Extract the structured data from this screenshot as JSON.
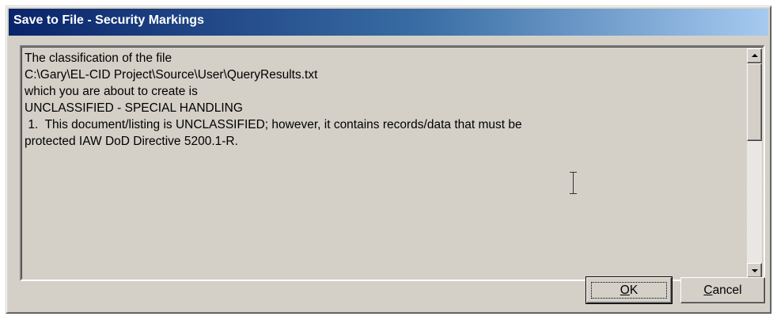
{
  "window": {
    "title": "Save to File - Security Markings"
  },
  "message": {
    "lines": [
      "The classification of the file",
      "",
      "C:\\Gary\\EL-CID Project\\Source\\User\\QueryResults.txt",
      "",
      "which you are about to create is",
      "",
      "UNCLASSIFIED - SPECIAL HANDLING",
      "",
      " 1.  This document/listing is UNCLASSIFIED; however, it contains records/data that must be",
      "protected IAW DoD Directive 5200.1-R."
    ]
  },
  "scrollbar": {
    "position": 0.0
  },
  "buttons": {
    "ok_label": "OK",
    "ok_mnemonic": "O",
    "cancel_label": "Cancel",
    "cancel_mnemonic": "C"
  },
  "icons": {
    "scroll_up": "arrow-up-icon",
    "scroll_down": "arrow-down-icon",
    "cursor": "text-cursor-icon"
  },
  "colors": {
    "titlebar_start": "#0a246a",
    "titlebar_end": "#a6caf0",
    "face": "#d4d0c8"
  }
}
